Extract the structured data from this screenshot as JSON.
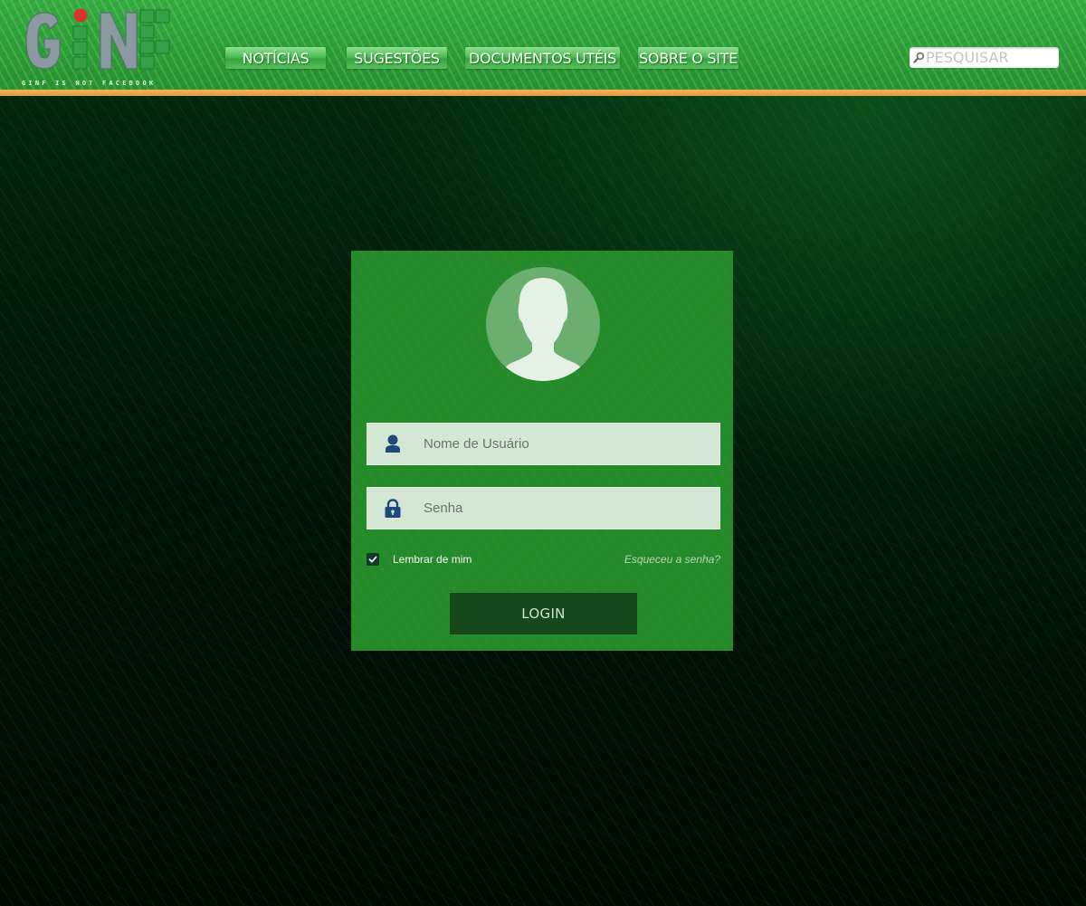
{
  "logo": {
    "text": "GINF",
    "tagline": "GINF IS NOT FACEBOOK"
  },
  "nav": {
    "items": [
      {
        "label": "NOTÍCIAS"
      },
      {
        "label": "SUGESTÕES"
      },
      {
        "label": "DOCUMENTOS UTÉIS"
      },
      {
        "label": "SOBRE O SITE"
      }
    ]
  },
  "search": {
    "placeholder": "PESQUISAR",
    "icon": "search-icon"
  },
  "login": {
    "avatar_icon": "user-silhouette-icon",
    "username_placeholder": "Nome de Usuário",
    "username_icon": "user-icon",
    "password_placeholder": "Senha",
    "password_icon": "lock-icon",
    "remember_label": "Lembrar de mim",
    "remember_checked": true,
    "forgot_label": "Esqueceu a senha?",
    "button_label": "LOGIN"
  },
  "colors": {
    "header_green": "#2a9b35",
    "accent_orange": "#f0a84e",
    "panel_green": "#258a2a",
    "button_dark_green": "#15491b",
    "field_background": "#d4e7d5",
    "icon_blue": "#1d4a7a",
    "logo_red_dot": "#d9332e"
  }
}
